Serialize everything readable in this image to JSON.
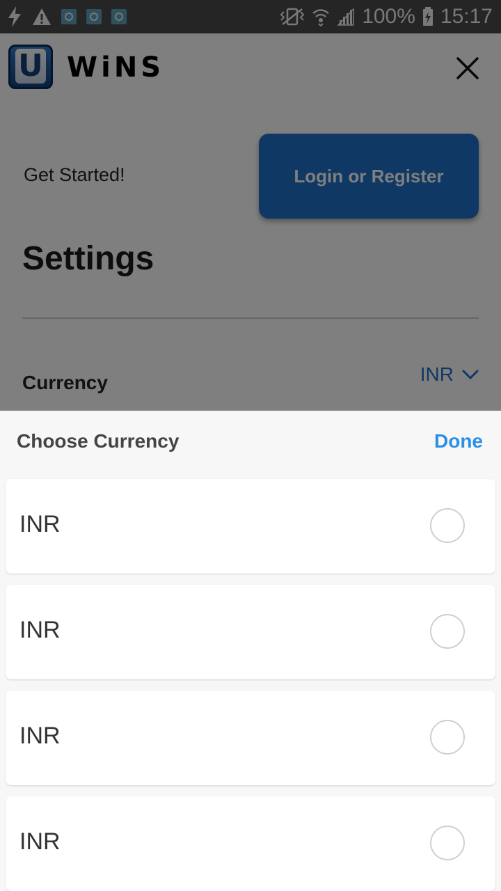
{
  "status_bar": {
    "battery": "100%",
    "time": "15:17",
    "left_icons": [
      "charging-bolt-icon",
      "warning-icon",
      "app-notification-icon",
      "app-notification-icon",
      "app-notification-icon"
    ],
    "right_icons": [
      "vibrate-icon",
      "wifi-icon",
      "signal-icon",
      "battery-charging-icon"
    ]
  },
  "header": {
    "logo_letter": "U",
    "logo_text": "WiNS"
  },
  "main": {
    "get_started": "Get Started!",
    "login_button": "Login or Register",
    "settings_title": "Settings",
    "currency_label": "Currency",
    "currency_value": "INR"
  },
  "sheet": {
    "title": "Choose Currency",
    "done": "Done",
    "options": [
      {
        "label": "INR",
        "selected": false
      },
      {
        "label": "INR",
        "selected": false
      },
      {
        "label": "INR",
        "selected": false
      },
      {
        "label": "INR",
        "selected": false
      }
    ]
  },
  "colors": {
    "accent": "#1e73c8",
    "done_blue": "#2b8fe6",
    "overlay": "#000000"
  }
}
